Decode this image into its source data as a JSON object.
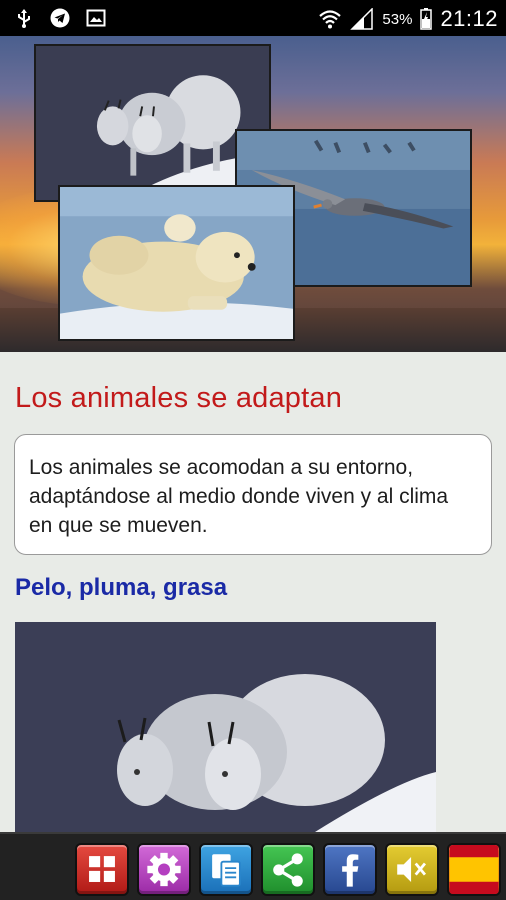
{
  "status_bar": {
    "battery_percent": "53%",
    "time": "21:12"
  },
  "article": {
    "title": "Los animales se adaptan",
    "intro": "Los animales se acomodan a su entorno, adaptándose al medio donde viven y al clima en que se mueven.",
    "section_title": "Pelo, pluma, grasa"
  },
  "toolbar": {
    "buttons": [
      {
        "name": "menu-grid-icon",
        "color": "#d3302a"
      },
      {
        "name": "gear-icon",
        "color": "#b43fc0"
      },
      {
        "name": "copy-icon",
        "color": "#2a86cc"
      },
      {
        "name": "share-icon",
        "color": "#2ea83c"
      },
      {
        "name": "facebook-icon",
        "color": "#3a5ca8"
      },
      {
        "name": "sound-muted-icon",
        "color": "#ccb21e"
      },
      {
        "name": "language-es-icon",
        "color": "#e66e18"
      }
    ],
    "language_label": "ES"
  },
  "colors": {
    "title": "#c21a1a",
    "section_title": "#1a2aa6",
    "background": "#e8ebe7"
  }
}
